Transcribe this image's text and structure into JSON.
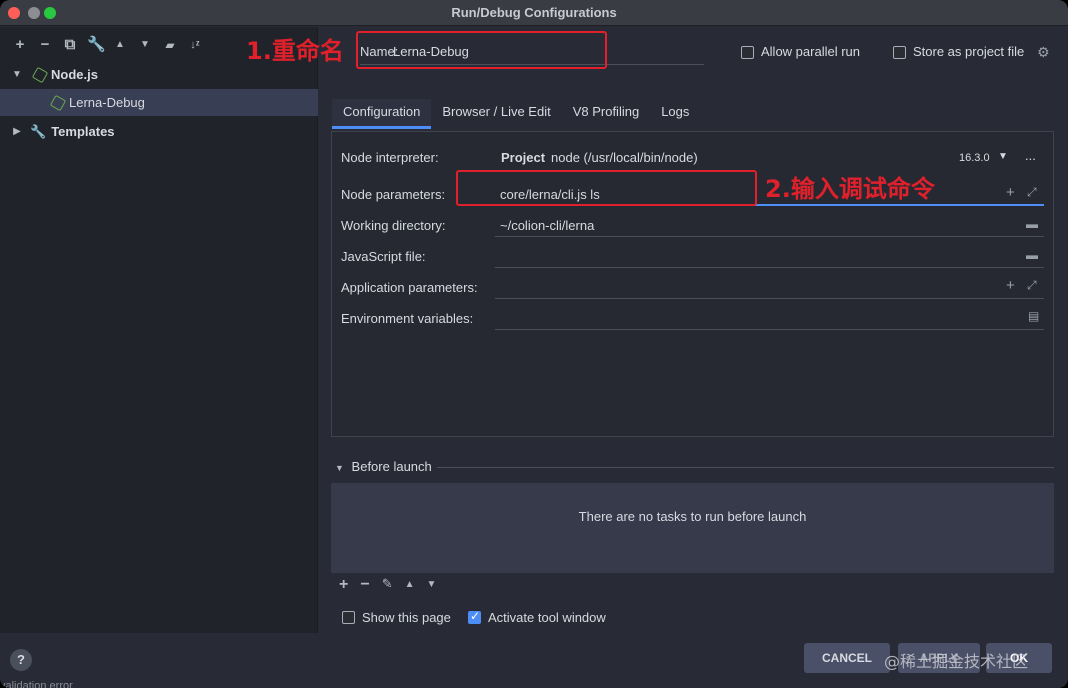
{
  "window": {
    "title": "Run/Debug Configurations"
  },
  "toolbar": {
    "add": "+",
    "remove": "−"
  },
  "tree": {
    "group": "Node.js",
    "item": "Lerna-Debug",
    "templates": "Templates"
  },
  "annotations": {
    "rename": "1.重命名",
    "input_cmd": "2.输入调试命令"
  },
  "header": {
    "name_label": "Name:",
    "name_value": "Lerna-Debug",
    "allow_parallel": "Allow parallel run",
    "store_project": "Store as project file"
  },
  "tabs": [
    "Configuration",
    "Browser / Live Edit",
    "V8 Profiling",
    "Logs"
  ],
  "form": {
    "interpreter_label": "Node interpreter:",
    "interpreter_project": "Project",
    "interpreter_value": "node (/usr/local/bin/node)",
    "interpreter_version": "16.3.0",
    "more": "...",
    "params_label": "Node parameters:",
    "params_value": "core/lerna/cli.js ls",
    "workdir_label": "Working directory:",
    "workdir_value": "~/colion-cli/lerna",
    "jsfile_label": "JavaScript file:",
    "app_params_label": "Application parameters:",
    "env_label": "Environment variables:"
  },
  "before_launch": {
    "title": "Before launch",
    "empty": "There are no tasks to run before launch",
    "show_page": "Show this page",
    "activate_tool": "Activate tool window"
  },
  "buttons": {
    "cancel": "CANCEL",
    "apply": "APPLY",
    "ok": "OK",
    "help": "?"
  },
  "watermark": "@稀土掘金技术社区",
  "status": "validation error"
}
